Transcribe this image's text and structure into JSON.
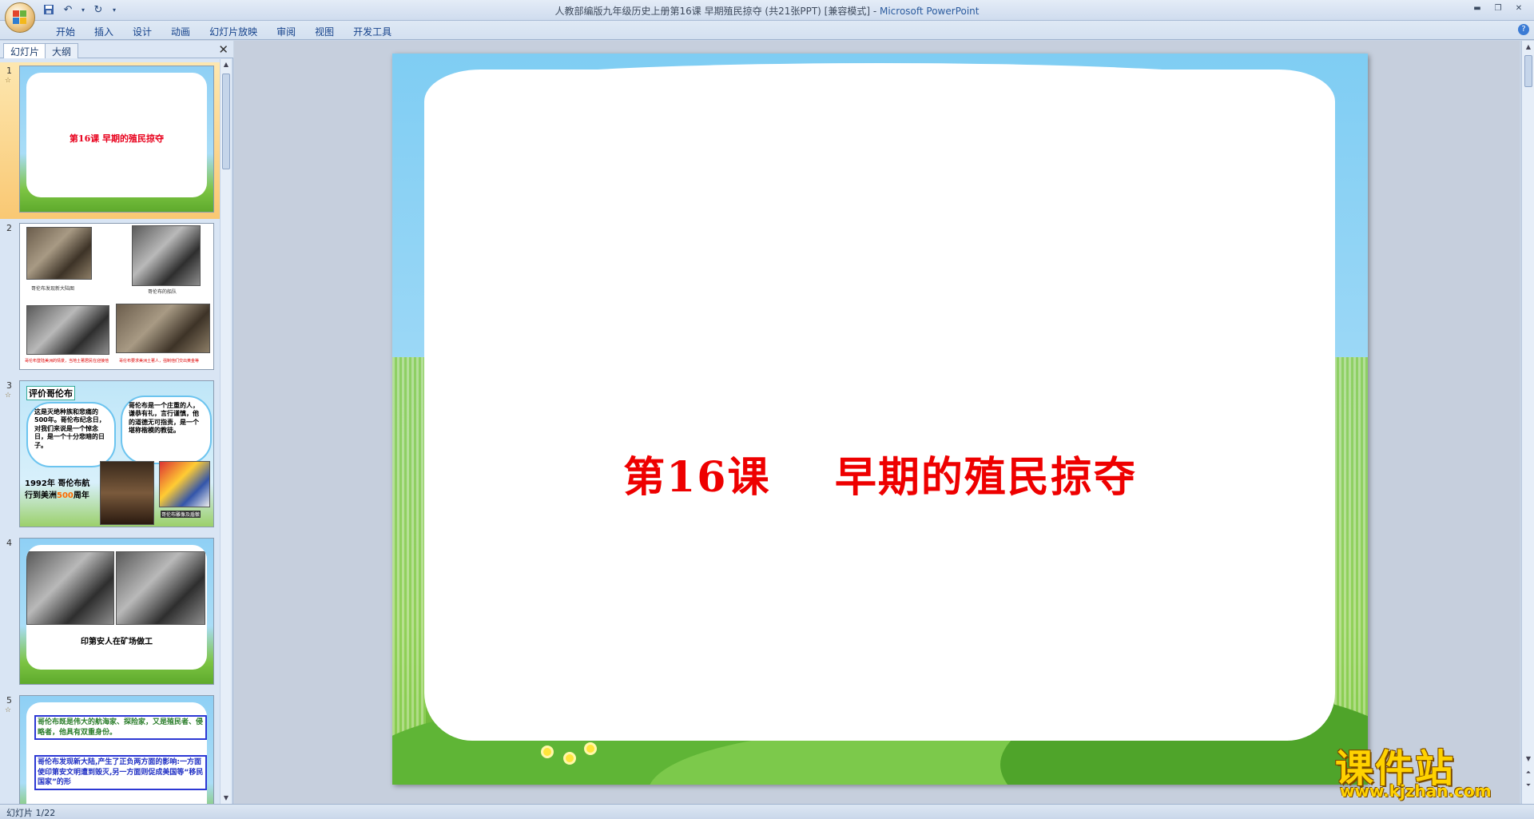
{
  "titlebar": {
    "document_title": "人教部编版九年级历史上册第16课  早期殖民掠夺 (共21张PPT) [兼容模式] - ",
    "app_name": "Microsoft PowerPoint",
    "qat_icons": [
      "save-icon",
      "undo-icon",
      "redo-icon",
      "customize-icon"
    ],
    "window_controls": [
      "minimize",
      "maximize",
      "close"
    ]
  },
  "ribbon": {
    "tabs": [
      "开始",
      "插入",
      "设计",
      "动画",
      "幻灯片放映",
      "审阅",
      "视图",
      "开发工具"
    ]
  },
  "left_pane": {
    "tabs": [
      "幻灯片",
      "大纲"
    ],
    "thumbnails": [
      {
        "number": "1",
        "title": "第16课   早期的殖民掠夺"
      },
      {
        "number": "2",
        "captions": [
          "哥伦布发现新大陆图",
          "哥伦布的船队",
          "哥伦布登陆美洲的情景，当地土著居民在迎接他",
          "哥伦布要求美洲土著人，强制他们交出黄金等"
        ]
      },
      {
        "number": "3",
        "title": "评价哥伦布",
        "cloud_left": "这是灭绝种族和悲痛的500年。哥伦布纪念日，对我们来说是一个悼念日，是一个十分悲暗的日子。",
        "cloud_right": "哥伦布是一个庄重的人，谦恭有礼，言行谨慎，他的道德无可指责，是一个堪称楷模的教徒。",
        "year_line1": "1992年  哥伦布航",
        "year_line2_a": "行到美洲",
        "year_line2_hl": "500",
        "year_line2_b": "周年",
        "caption": "哥伦布雕像及盾徽"
      },
      {
        "number": "4",
        "caption": "印第安人在矿场做工"
      },
      {
        "number": "5",
        "box1": "哥伦布既是伟大的航海家、探险家，又是殖民者、侵略者，他具有双重身份。",
        "box2": "哥伦布发现新大陆,产生了正负两方面的影响:一方面使印第安文明遭到毁灭,另一方面则促成美国等“移民国家”的形"
      }
    ]
  },
  "slide": {
    "title": "第16课    早期的殖民掠夺"
  },
  "watermark": {
    "text": "课件站",
    "url": "www.kjzhan.com"
  },
  "statusbar": {
    "text": "幻灯片 1/22"
  }
}
